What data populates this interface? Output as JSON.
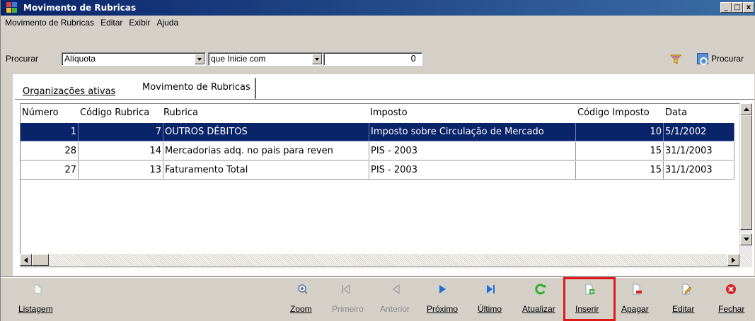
{
  "window": {
    "title": "Movimento de Rubricas"
  },
  "menu": [
    "Movimento de Rubricas",
    "Editar",
    "Exibir",
    "Ajuda"
  ],
  "search": {
    "label": "Procurar",
    "field": "Alíquota",
    "condition": "que Inicie com",
    "value": "0",
    "button": "Procurar"
  },
  "tabs": [
    {
      "label": "Organizações ativas",
      "active": false
    },
    {
      "label": "Movimento de Rubricas",
      "active": true
    }
  ],
  "grid": {
    "columns": [
      "Número",
      "Código Rubrica",
      "Rubrica",
      "Imposto",
      "Código Imposto",
      "Data"
    ],
    "rows": [
      {
        "numero": "1",
        "codigo_rubrica": "7",
        "rubrica": "OUTROS DÉBITOS",
        "imposto": "Imposto sobre Circulação de Mercado",
        "codigo_imposto": "10",
        "data": "5/1/2002",
        "selected": true
      },
      {
        "numero": "28",
        "codigo_rubrica": "14",
        "rubrica": "Mercadorias adq. no pais para reven",
        "imposto": "PIS - 2003",
        "codigo_imposto": "15",
        "data": "31/1/2003",
        "selected": false
      },
      {
        "numero": "27",
        "codigo_rubrica": "13",
        "rubrica": "Faturamento Total",
        "imposto": "PIS - 2003",
        "codigo_imposto": "15",
        "data": "31/1/2003",
        "selected": false
      }
    ]
  },
  "toolbar": {
    "listagem": "Listagem",
    "zoom": "Zoom",
    "primeiro": "Primeiro",
    "anterior": "Anterior",
    "proximo": "Próximo",
    "ultimo": "Último",
    "atualizar": "Atualizar",
    "inserir": "Inserir",
    "apagar": "Apagar",
    "editar": "Editar",
    "fechar": "Fechar"
  },
  "colors": {
    "titlebar": "#0a246a",
    "selection": "#0a246a",
    "highlight": "#e01818",
    "nav_blue": "#1f6fd6",
    "refresh_green": "#2fae2f",
    "close_red": "#d42020"
  }
}
